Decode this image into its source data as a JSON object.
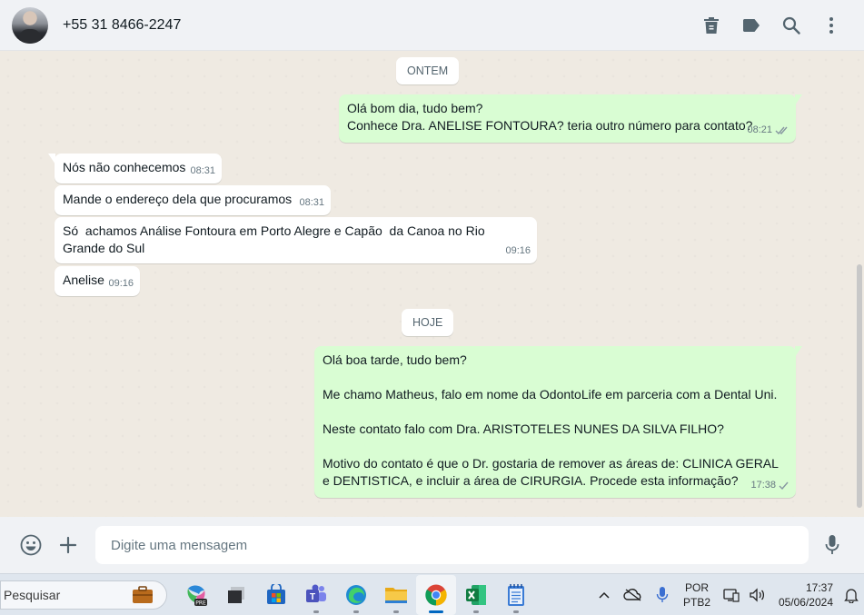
{
  "header": {
    "contact_name": "+55 31 8466-2247",
    "icons": [
      "delete-chat-icon",
      "label-icon",
      "search-icon",
      "more-options-icon"
    ]
  },
  "chat": {
    "dates": {
      "yesterday": "ONTEM",
      "today": "HOJE"
    },
    "messages": [
      {
        "direction": "out",
        "text": "Olá bom dia, tudo bem?\nConhece Dra. ANELISE FONTOURA? teria outro número para contato?",
        "time": "08:21",
        "status": "read"
      },
      {
        "direction": "in",
        "text": "Nós não conhecemos",
        "time": "08:31"
      },
      {
        "direction": "in",
        "text": "Mande o endereço dela que procuramos",
        "time": "08:31"
      },
      {
        "direction": "in",
        "text": "Só  achamos Análise Fontoura em Porto Alegre e Capão  da Canoa no Rio Grande do Sul",
        "time": "09:16"
      },
      {
        "direction": "in",
        "text": "Anelise",
        "time": "09:16"
      },
      {
        "direction": "out",
        "text": "Olá boa tarde, tudo bem?\n\nMe chamo Matheus, falo em nome da OdontoLife em parceria com a Dental Uni.\n\nNeste contato falo com Dra. ARISTOTELES NUNES DA SILVA FILHO?\n\nMotivo do contato é que o Dr. gostaria de remover as áreas de: CLINICA GERAL e DENTISTICA, e incluir a área de CIRURGIA. Procede esta informação?",
        "time": "17:38",
        "status": "sent"
      }
    ]
  },
  "composer": {
    "placeholder": "Digite uma mensagem"
  },
  "taskbar": {
    "search_label": "Pesquisar",
    "language_line1": "POR",
    "language_line2": "PTB2",
    "time": "17:37",
    "date": "05/06/2024",
    "colors": {
      "outgoing_bubble": "#d9fdd3",
      "chat_bg": "#efeae2",
      "check_read": "#53bdeb"
    }
  }
}
